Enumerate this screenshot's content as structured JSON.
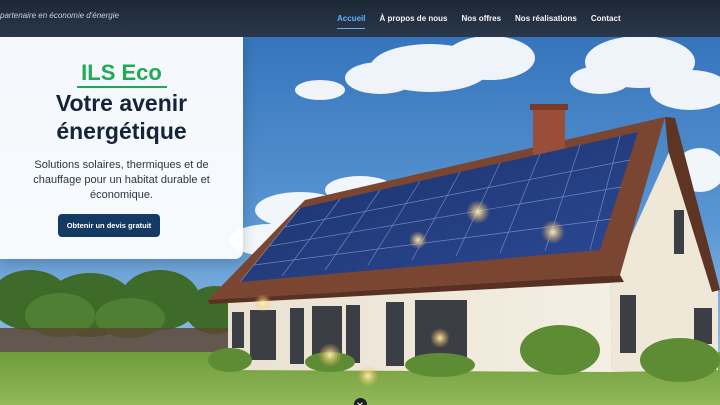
{
  "header": {
    "tagline": "partenaire en économie d'énergie",
    "nav": [
      {
        "label": "Accueil",
        "active": true
      },
      {
        "label": "À propos de nous",
        "active": false
      },
      {
        "label": "Nos offres",
        "active": false
      },
      {
        "label": "Nos réalisations",
        "active": false
      },
      {
        "label": "Contact",
        "active": false
      }
    ]
  },
  "hero": {
    "brand": "ILS Eco",
    "headline_line1": "Votre avenir",
    "headline_line2": "énergétique",
    "subtitle": "Solutions solaires, thermiques et de chauffage pour un habitat durable et économique.",
    "cta_label": "Obtenir un devis gratuit"
  },
  "colors": {
    "nav_bg": "#1d2836",
    "nav_active": "#5bb2ff",
    "brand_green": "#1faa54",
    "cta_bg": "#143a64"
  },
  "icons": {
    "scroll_indicator": "chevron-down-icon"
  }
}
